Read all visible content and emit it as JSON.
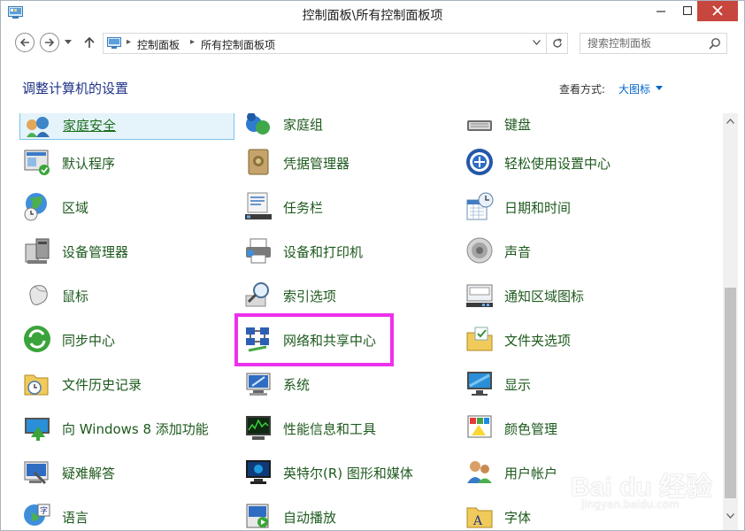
{
  "window": {
    "title": "控制面板\\所有控制面板项"
  },
  "nav": {
    "breadcrumb": [
      "控制面板",
      "所有控制面板项"
    ],
    "search_placeholder": "搜索控制面板"
  },
  "header": {
    "heading": "调整计算机的设置",
    "view_by_label": "查看方式:",
    "view_by_value": "大图标"
  },
  "items": [
    {
      "label": "家庭安全",
      "icon": "family-safety-icon"
    },
    {
      "label": "家庭组",
      "icon": "homegroup-icon"
    },
    {
      "label": "键盘",
      "icon": "keyboard-icon"
    },
    {
      "label": "默认程序",
      "icon": "default-programs-icon"
    },
    {
      "label": "凭据管理器",
      "icon": "credential-manager-icon"
    },
    {
      "label": "轻松使用设置中心",
      "icon": "ease-of-access-icon"
    },
    {
      "label": "区域",
      "icon": "region-icon"
    },
    {
      "label": "任务栏",
      "icon": "taskbar-icon"
    },
    {
      "label": "日期和时间",
      "icon": "date-time-icon"
    },
    {
      "label": "设备管理器",
      "icon": "device-manager-icon"
    },
    {
      "label": "设备和打印机",
      "icon": "devices-printers-icon"
    },
    {
      "label": "声音",
      "icon": "sound-icon"
    },
    {
      "label": "鼠标",
      "icon": "mouse-icon"
    },
    {
      "label": "索引选项",
      "icon": "indexing-options-icon"
    },
    {
      "label": "通知区域图标",
      "icon": "notification-area-icon"
    },
    {
      "label": "同步中心",
      "icon": "sync-center-icon"
    },
    {
      "label": "网络和共享中心",
      "icon": "network-sharing-icon"
    },
    {
      "label": "文件夹选项",
      "icon": "folder-options-icon"
    },
    {
      "label": "文件历史记录",
      "icon": "file-history-icon"
    },
    {
      "label": "系统",
      "icon": "system-icon"
    },
    {
      "label": "显示",
      "icon": "display-icon"
    },
    {
      "label": "向 Windows 8 添加功能",
      "icon": "add-features-icon"
    },
    {
      "label": "性能信息和工具",
      "icon": "performance-icon"
    },
    {
      "label": "颜色管理",
      "icon": "color-management-icon"
    },
    {
      "label": "疑难解答",
      "icon": "troubleshooting-icon"
    },
    {
      "label": "英特尔(R) 图形和媒体",
      "icon": "intel-graphics-icon"
    },
    {
      "label": "用户帐户",
      "icon": "user-accounts-icon"
    },
    {
      "label": "语言",
      "icon": "language-icon"
    },
    {
      "label": "自动播放",
      "icon": "autoplay-icon"
    },
    {
      "label": "字体",
      "icon": "fonts-icon"
    }
  ],
  "watermark": {
    "text": "Bai du 经验",
    "sub": "jingyan.baidu.com"
  }
}
